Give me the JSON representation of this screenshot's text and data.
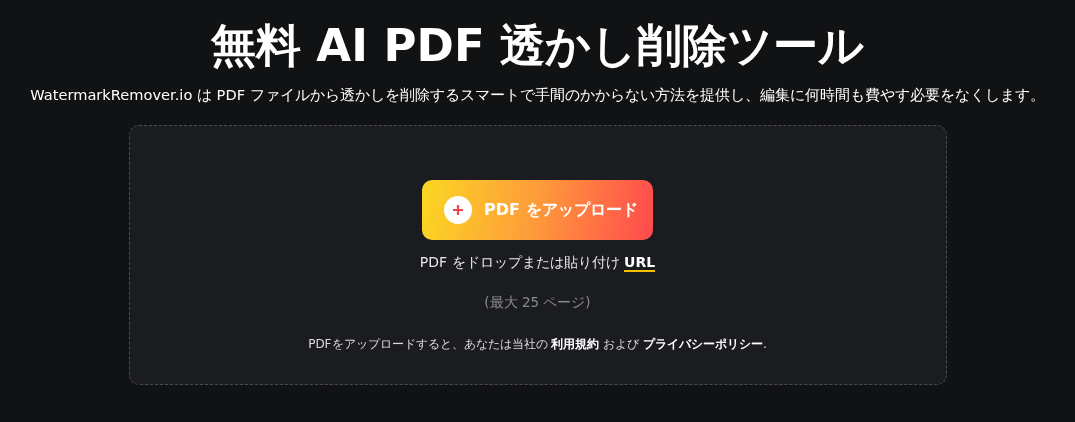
{
  "title": "無料 AI PDF 透かし削除ツール",
  "subtitle": "WatermarkRemover.io は PDF ファイルから透かしを削除するスマートで手間のかからない方法を提供し、編集に何時間も費やす必要をなくします。",
  "upload": {
    "button": "PDF をアップロード",
    "drop_text": "PDF をドロップまたは貼り付け",
    "url_link": "URL",
    "limit": "(最大 25 ページ)",
    "legal": {
      "before": "PDFをアップロードすると、あなたは当社の",
      "terms_link": "利用規約",
      "middle": "および",
      "privacy_link": "プライバシーポリシー",
      "after": "."
    }
  }
}
